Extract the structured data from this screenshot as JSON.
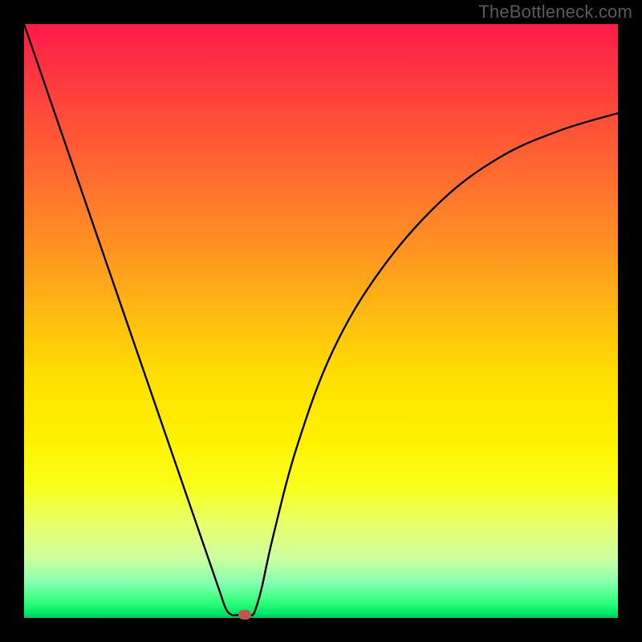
{
  "watermark": "TheBottleneck.com",
  "chart_data": {
    "type": "line",
    "title": "",
    "xlabel": "",
    "ylabel": "",
    "xlim": [
      0,
      100
    ],
    "ylim": [
      0,
      100
    ],
    "series": [
      {
        "name": "curve",
        "x": [
          0,
          5,
          10,
          15,
          20,
          25,
          30,
          33,
          34,
          35,
          36,
          37,
          38,
          38.5,
          39,
          40,
          42,
          46,
          52,
          60,
          70,
          80,
          90,
          100
        ],
        "values": [
          100,
          85.5,
          71,
          56.5,
          42,
          27.5,
          13,
          4.3,
          1.5,
          0.5,
          0.5,
          0.5,
          0.5,
          0.5,
          1.5,
          5,
          14,
          29,
          45,
          58.5,
          70,
          77.5,
          82,
          85
        ]
      }
    ],
    "marker": {
      "x": 37.2,
      "y": 0.5
    },
    "background_gradient": {
      "top": "#ff1a4a",
      "middle": "#fff200",
      "bottom": "#00c85c"
    }
  }
}
